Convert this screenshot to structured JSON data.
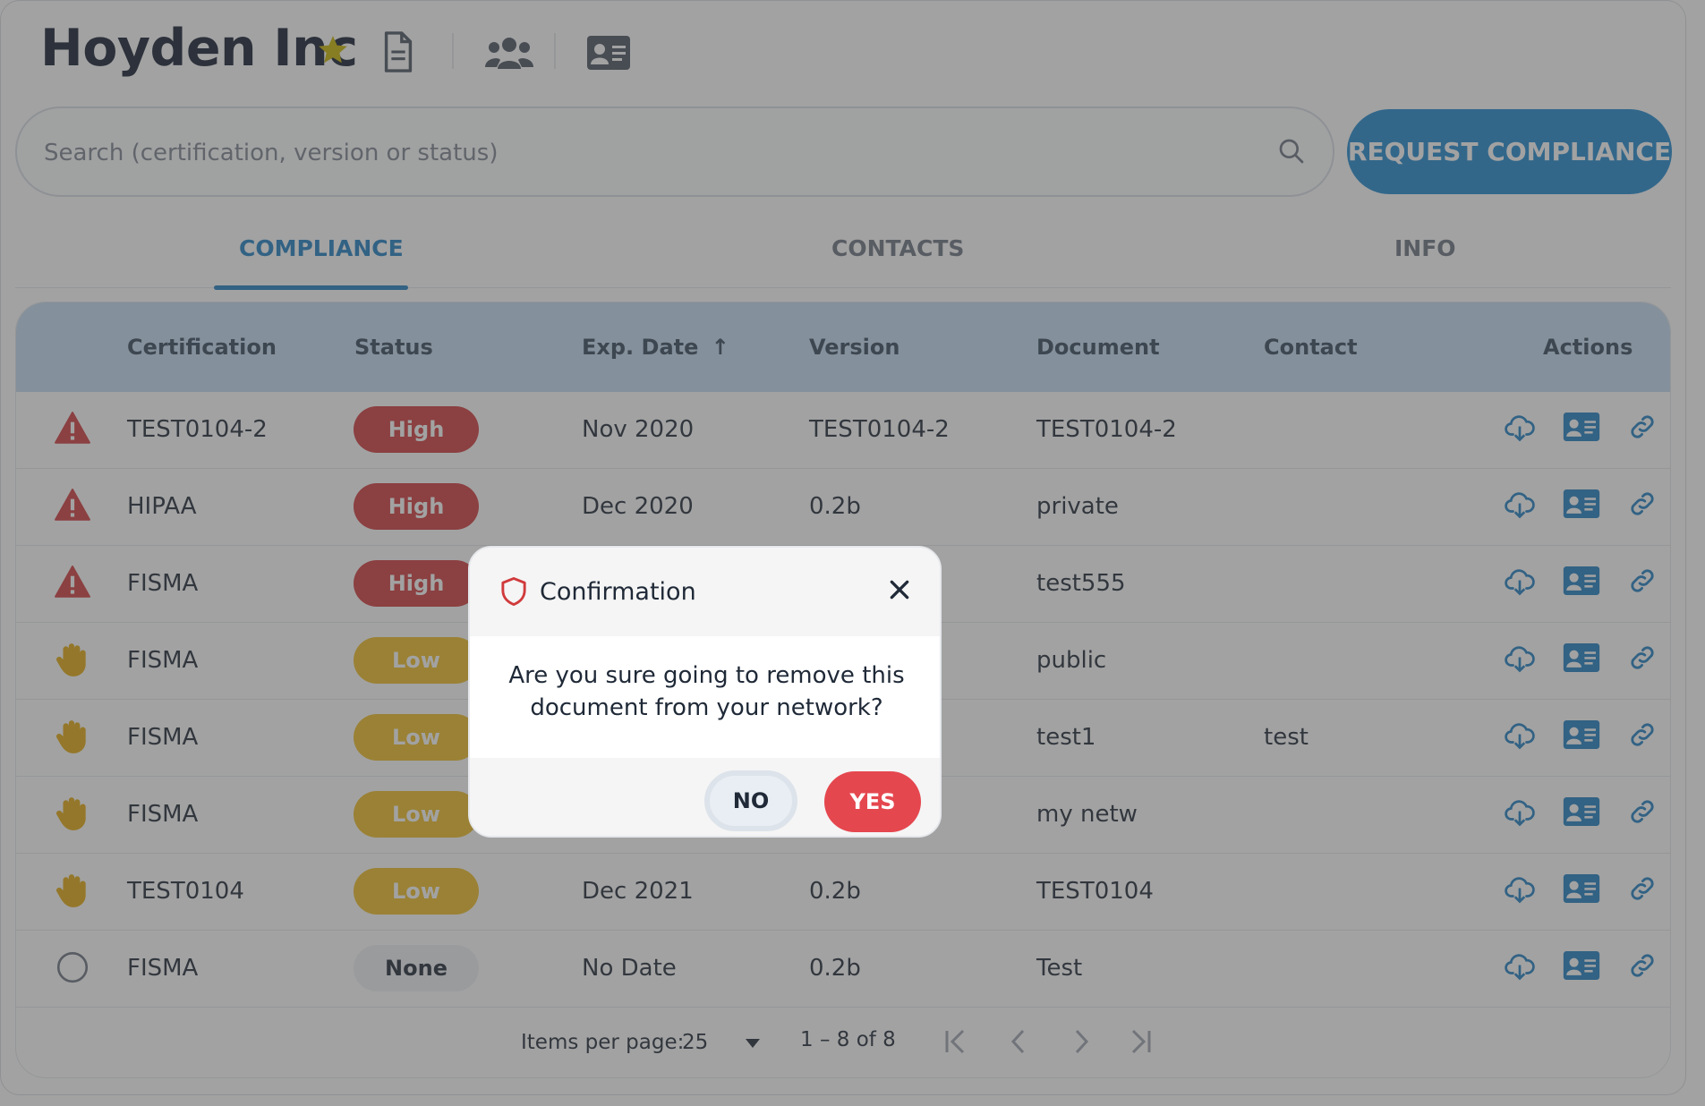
{
  "header": {
    "title": "Hoyden Inc"
  },
  "search": {
    "placeholder": "Search (certification, version or status)"
  },
  "request_button": "REQUEST COMPLIANCE",
  "tabs": [
    {
      "label": "COMPLIANCE",
      "active": true
    },
    {
      "label": "CONTACTS",
      "active": false
    },
    {
      "label": "INFO",
      "active": false
    }
  ],
  "table": {
    "columns": [
      "Certification",
      "Status",
      "Exp. Date",
      "Version",
      "Document",
      "Contact",
      "Actions"
    ],
    "sort_indicator": "↑",
    "rows": [
      {
        "risk": "warning",
        "certification": "TEST0104-2",
        "status": "High",
        "exp_date": "Nov 2020",
        "version": "TEST0104-2",
        "document": "TEST0104-2",
        "contact": ""
      },
      {
        "risk": "warning",
        "certification": "HIPAA",
        "status": "High",
        "exp_date": "Dec 2020",
        "version": "0.2b",
        "document": "private",
        "contact": ""
      },
      {
        "risk": "warning",
        "certification": "FISMA",
        "status": "High",
        "exp_date": "",
        "version": "",
        "document": "test555",
        "contact": ""
      },
      {
        "risk": "hand",
        "certification": "FISMA",
        "status": "Low",
        "exp_date": "",
        "version": "",
        "document": "public",
        "contact": ""
      },
      {
        "risk": "hand",
        "certification": "FISMA",
        "status": "Low",
        "exp_date": "",
        "version": "",
        "document": "test1",
        "contact": "test"
      },
      {
        "risk": "hand",
        "certification": "FISMA",
        "status": "Low",
        "exp_date": "",
        "version": "",
        "document": "my netw",
        "contact": ""
      },
      {
        "risk": "hand",
        "certification": "TEST0104",
        "status": "Low",
        "exp_date": "Dec 2021",
        "version": "0.2b",
        "document": "TEST0104",
        "contact": ""
      },
      {
        "risk": "circle",
        "certification": "FISMA",
        "status": "None",
        "exp_date": "No Date",
        "version": "0.2b",
        "document": "Test",
        "contact": ""
      }
    ]
  },
  "pagination": {
    "items_per_page_label": "Items per page:",
    "items_per_page_value": "25",
    "range": "1 – 8 of 8"
  },
  "dialog": {
    "title": "Confirmation",
    "message": "Are you sure going to remove this document from your network?",
    "no_label": "NO",
    "yes_label": "YES"
  },
  "colors": {
    "accent": "#1e88cf",
    "high": "#d13a3c",
    "low": "#efbc24",
    "yes": "#e5474f"
  }
}
